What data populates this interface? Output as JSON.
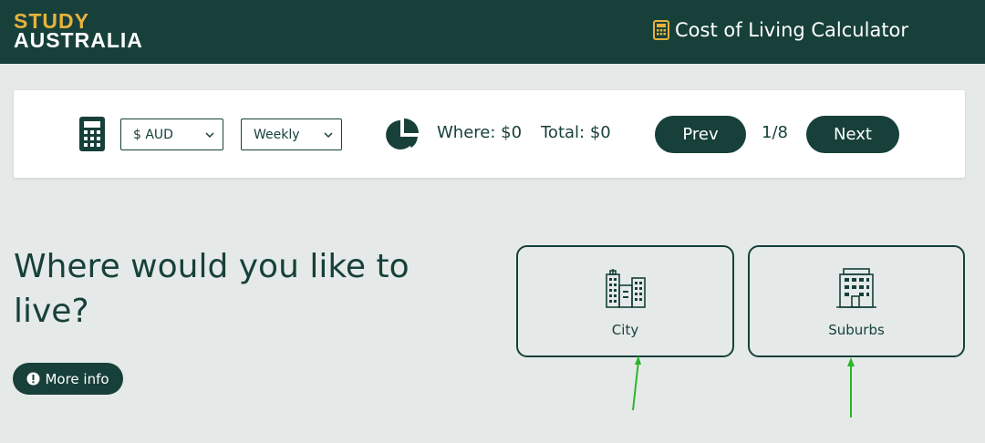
{
  "header": {
    "logo_line1": "STUDY",
    "logo_line2": "AUSTRALIA",
    "title": "Cost of Living Calculator",
    "title_icon": "calculator-icon"
  },
  "toolbar": {
    "calculator_icon": "calculator-icon",
    "currency_select": {
      "value": "$ AUD"
    },
    "period_select": {
      "value": "Weekly"
    },
    "chart_icon": "pie-chart-icon",
    "where_text": "Where: $0",
    "total_text": "Total: $0",
    "prev_label": "Prev",
    "page_indicator": "1/8",
    "next_label": "Next"
  },
  "main": {
    "question": "Where would you like to live?",
    "more_info_label": "More info",
    "options": [
      {
        "label": "City",
        "icon": "city-buildings-icon"
      },
      {
        "label": "Suburbs",
        "icon": "suburbs-building-icon"
      }
    ]
  },
  "colors": {
    "primary": "#17403a",
    "accent": "#e5b33c",
    "background": "#e5eae8",
    "annotation_arrow": "#2db52d"
  }
}
